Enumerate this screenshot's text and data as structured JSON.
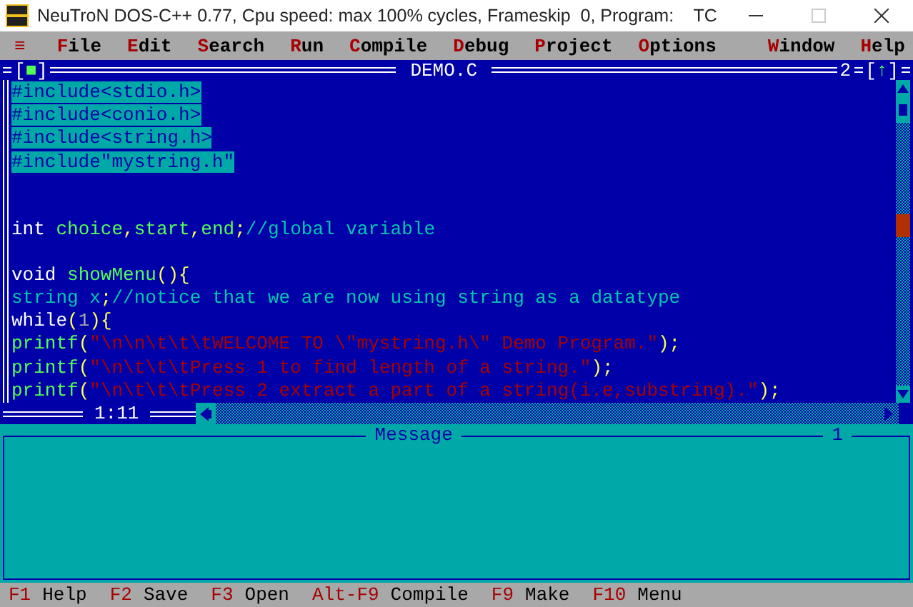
{
  "window": {
    "title": "NeuTroN DOS-C++ 0.77, Cpu speed: max 100% cycles, Frameskip  0, Program:    TC"
  },
  "menu": {
    "system": "≡",
    "items": [
      "File",
      "Edit",
      "Search",
      "Run",
      "Compile",
      "Debug",
      "Project",
      "Options"
    ],
    "right_items": [
      "Window",
      "Help"
    ]
  },
  "editor": {
    "close_button": "[■]",
    "title": "DEMO.C",
    "number": "2",
    "zoom_button": "[↑]",
    "position": "1:11",
    "lines": [
      {
        "kind": "code",
        "selected": true,
        "segments": [
          {
            "kind": "plain",
            "text": "#include<stdio.h>"
          }
        ]
      },
      {
        "kind": "code",
        "selected": true,
        "segments": [
          {
            "kind": "plain",
            "text": "#include<conio.h>"
          }
        ]
      },
      {
        "kind": "code",
        "selected": true,
        "segments": [
          {
            "kind": "plain",
            "text": "#include<string.h>"
          }
        ]
      },
      {
        "kind": "code",
        "selected": true,
        "segments": [
          {
            "kind": "plain",
            "text": "#include\"mystring.h\""
          }
        ]
      },
      {
        "kind": "blank"
      },
      {
        "kind": "blank"
      },
      {
        "kind": "code",
        "selected": false,
        "segments": [
          {
            "kind": "keyword",
            "text": "int "
          },
          {
            "kind": "ident",
            "text": "choice"
          },
          {
            "kind": "punct",
            "text": ","
          },
          {
            "kind": "ident",
            "text": "start"
          },
          {
            "kind": "punct",
            "text": ","
          },
          {
            "kind": "ident",
            "text": "end"
          },
          {
            "kind": "punct",
            "text": ";"
          },
          {
            "kind": "comment",
            "text": "//global variable"
          }
        ]
      },
      {
        "kind": "blank"
      },
      {
        "kind": "code",
        "selected": false,
        "segments": [
          {
            "kind": "keyword",
            "text": "void "
          },
          {
            "kind": "ident",
            "text": "showMenu"
          },
          {
            "kind": "punct",
            "text": "(){"
          }
        ]
      },
      {
        "kind": "code",
        "selected": false,
        "segments": [
          {
            "kind": "comment",
            "text": "string x"
          },
          {
            "kind": "punct",
            "text": ";"
          },
          {
            "kind": "comment",
            "text": "//notice that we are now using string as a datatype"
          }
        ]
      },
      {
        "kind": "code",
        "selected": false,
        "segments": [
          {
            "kind": "keyword",
            "text": "while"
          },
          {
            "kind": "punct",
            "text": "("
          },
          {
            "kind": "number",
            "text": "1"
          },
          {
            "kind": "punct",
            "text": "){"
          }
        ]
      },
      {
        "kind": "code",
        "selected": false,
        "segments": [
          {
            "kind": "ident",
            "text": "printf"
          },
          {
            "kind": "punct",
            "text": "("
          },
          {
            "kind": "string",
            "text": "\"\\n\\n\\t\\t\\tWELCOME TO \\\"mystring.h\\\" Demo Program.\""
          },
          {
            "kind": "punct",
            "text": ");"
          }
        ]
      },
      {
        "kind": "code",
        "selected": false,
        "segments": [
          {
            "kind": "ident",
            "text": "printf"
          },
          {
            "kind": "punct",
            "text": "("
          },
          {
            "kind": "string",
            "text": "\"\\n\\t\\t\\tPress 1 to find length of a string.\""
          },
          {
            "kind": "punct",
            "text": ");"
          }
        ]
      },
      {
        "kind": "code",
        "selected": false,
        "segments": [
          {
            "kind": "ident",
            "text": "printf"
          },
          {
            "kind": "punct",
            "text": "("
          },
          {
            "kind": "string",
            "text": "\"\\n\\t\\t\\tPress 2 extract a part of a string(i.e,substring).\""
          },
          {
            "kind": "punct",
            "text": ");"
          }
        ]
      }
    ]
  },
  "message": {
    "title": "Message",
    "number": "1"
  },
  "status_bar": [
    {
      "key": "F1",
      "label": "Help"
    },
    {
      "key": "F2",
      "label": "Save"
    },
    {
      "key": "F3",
      "label": "Open"
    },
    {
      "key": "Alt-F9",
      "label": "Compile"
    },
    {
      "key": "F9",
      "label": "Make"
    },
    {
      "key": "F10",
      "label": "Menu"
    }
  ]
}
